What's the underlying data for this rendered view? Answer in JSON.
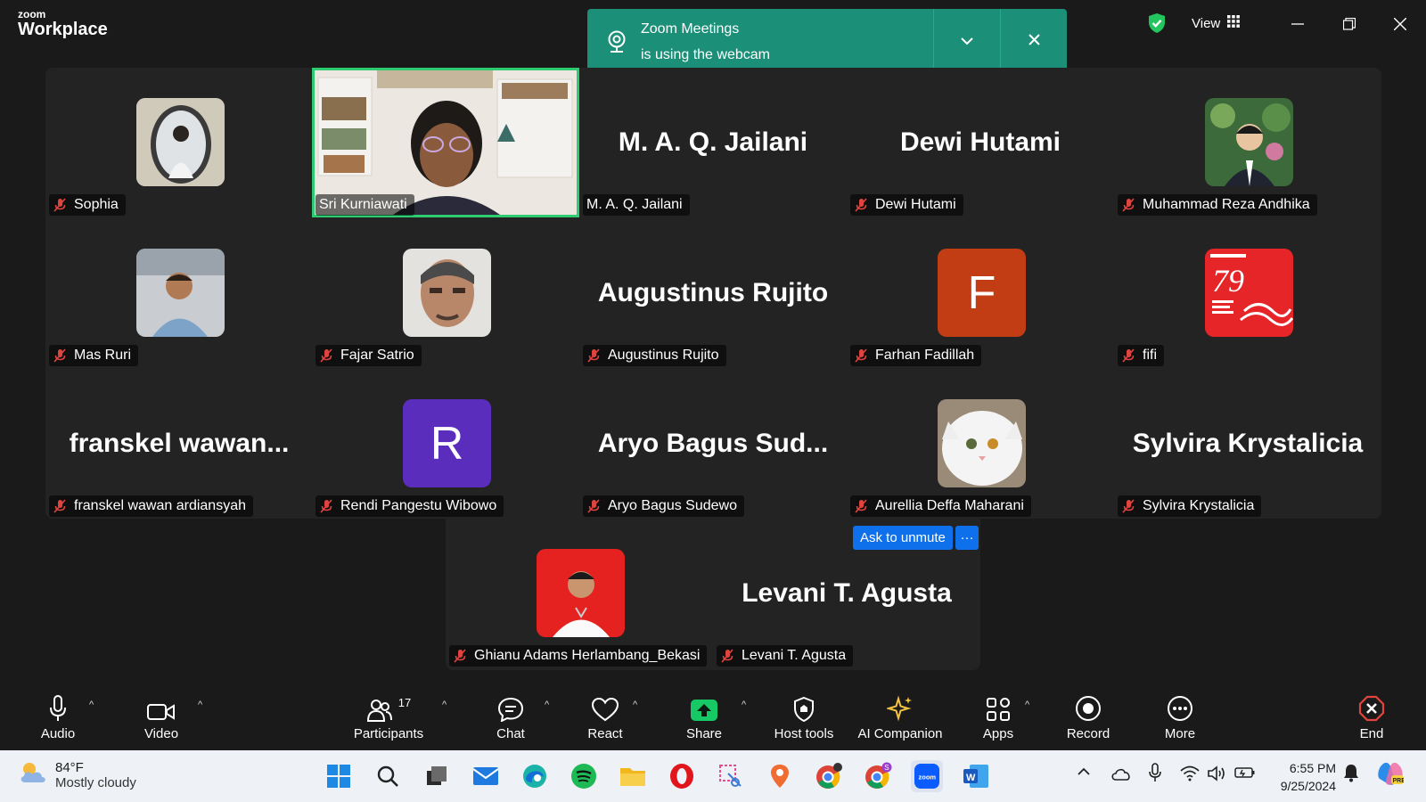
{
  "app": {
    "logo_small": "zoom",
    "logo_big": "Workplace"
  },
  "toast": {
    "line1": "Zoom Meetings",
    "line2": "is using the webcam"
  },
  "header": {
    "view_label": "View"
  },
  "tiles": [
    {
      "name": "Sophia"
    },
    {
      "name": "Sri Kurniawati"
    },
    {
      "name": "M. A. Q. Jailani",
      "big": "M. A. Q. Jailani"
    },
    {
      "name": "Dewi Hutami",
      "big": "Dewi Hutami"
    },
    {
      "name": "Muhammad Reza Andhika"
    },
    {
      "name": "Mas Ruri"
    },
    {
      "name": "Fajar Satrio"
    },
    {
      "name": "Augustinus Rujito",
      "big": "Augustinus Rujito"
    },
    {
      "name": "Farhan Fadillah",
      "letter": "F"
    },
    {
      "name": "fifi"
    },
    {
      "name": "franskel wawan ardiansyah",
      "big": "franskel  wawan..."
    },
    {
      "name": "Rendi Pangestu Wibowo",
      "letter": "R"
    },
    {
      "name": "Aryo Bagus Sudewo",
      "big": "Aryo  Bagus  Sud..."
    },
    {
      "name": "Aurellia Deffa Maharani"
    },
    {
      "name": "Sylvira Krystalicia",
      "big": "Sylvira Krystalicia"
    },
    {
      "name": "Ghianu Adams Herlambang_Bekasi"
    },
    {
      "name": "Levani T. Agusta",
      "big": "Levani T. Agusta"
    }
  ],
  "ask_unmute": "Ask to unmute",
  "ask_more": "···",
  "toolbar": {
    "audio": "Audio",
    "video": "Video",
    "participants": "Participants",
    "participants_count": "17",
    "chat": "Chat",
    "react": "React",
    "share": "Share",
    "host_tools": "Host tools",
    "ai_companion": "AI Companion",
    "apps": "Apps",
    "record": "Record",
    "more": "More",
    "end": "End"
  },
  "taskbar": {
    "temp": "84°F",
    "weather": "Mostly cloudy",
    "time": "6:55 PM",
    "date": "9/25/2024"
  },
  "colors": {
    "accent_green": "#1b8f77",
    "active_speaker": "#2ecc71",
    "blue": "#0e71eb",
    "muted_red": "#e0443e",
    "avatar_F": "#c33d14",
    "avatar_R": "#5b2dbd"
  }
}
